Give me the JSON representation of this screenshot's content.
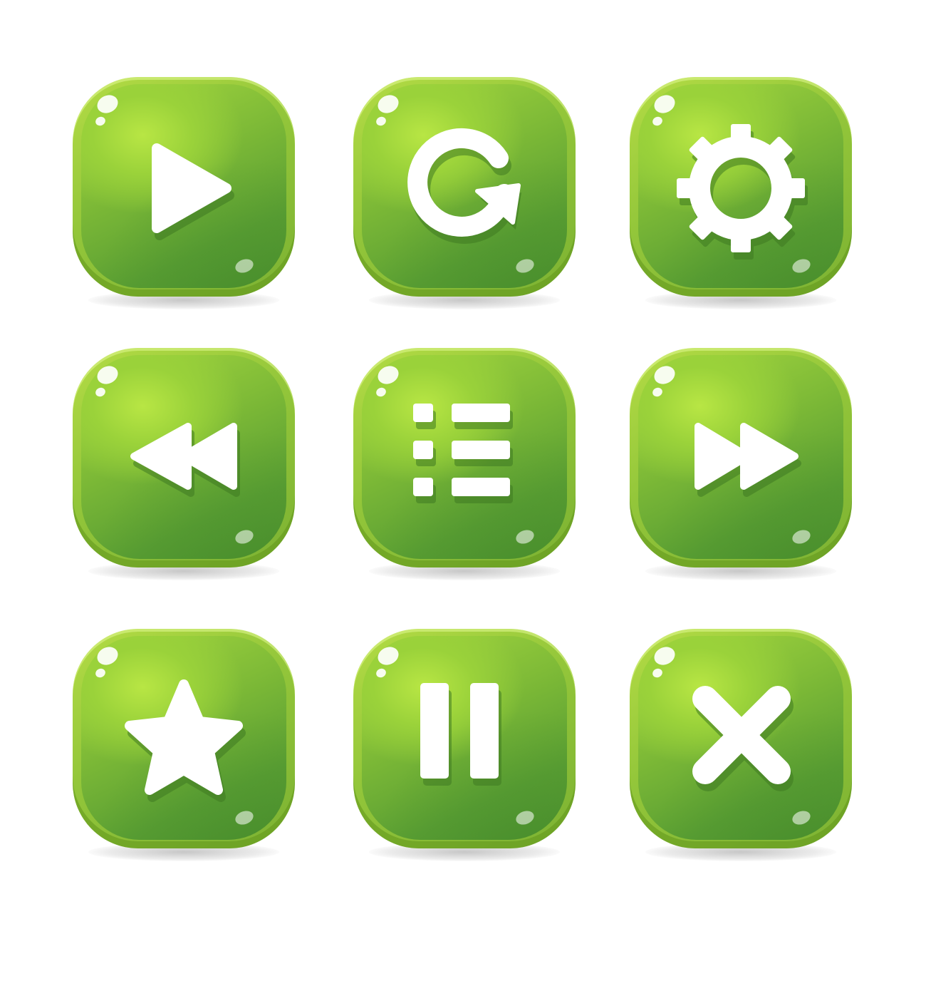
{
  "colors": {
    "button_light": "#b4dc45",
    "button_mid": "#7fbb37",
    "button_dark": "#4f942f",
    "icon_fill": "#ffffff",
    "icon_shadow": "#3f7a22",
    "background": "#ffffff"
  },
  "buttons": [
    {
      "icon": "play-icon"
    },
    {
      "icon": "restart-icon"
    },
    {
      "icon": "settings-gear-icon"
    },
    {
      "icon": "rewind-icon"
    },
    {
      "icon": "menu-list-icon"
    },
    {
      "icon": "fast-forward-icon"
    },
    {
      "icon": "star-icon"
    },
    {
      "icon": "pause-icon"
    },
    {
      "icon": "close-x-icon"
    }
  ]
}
